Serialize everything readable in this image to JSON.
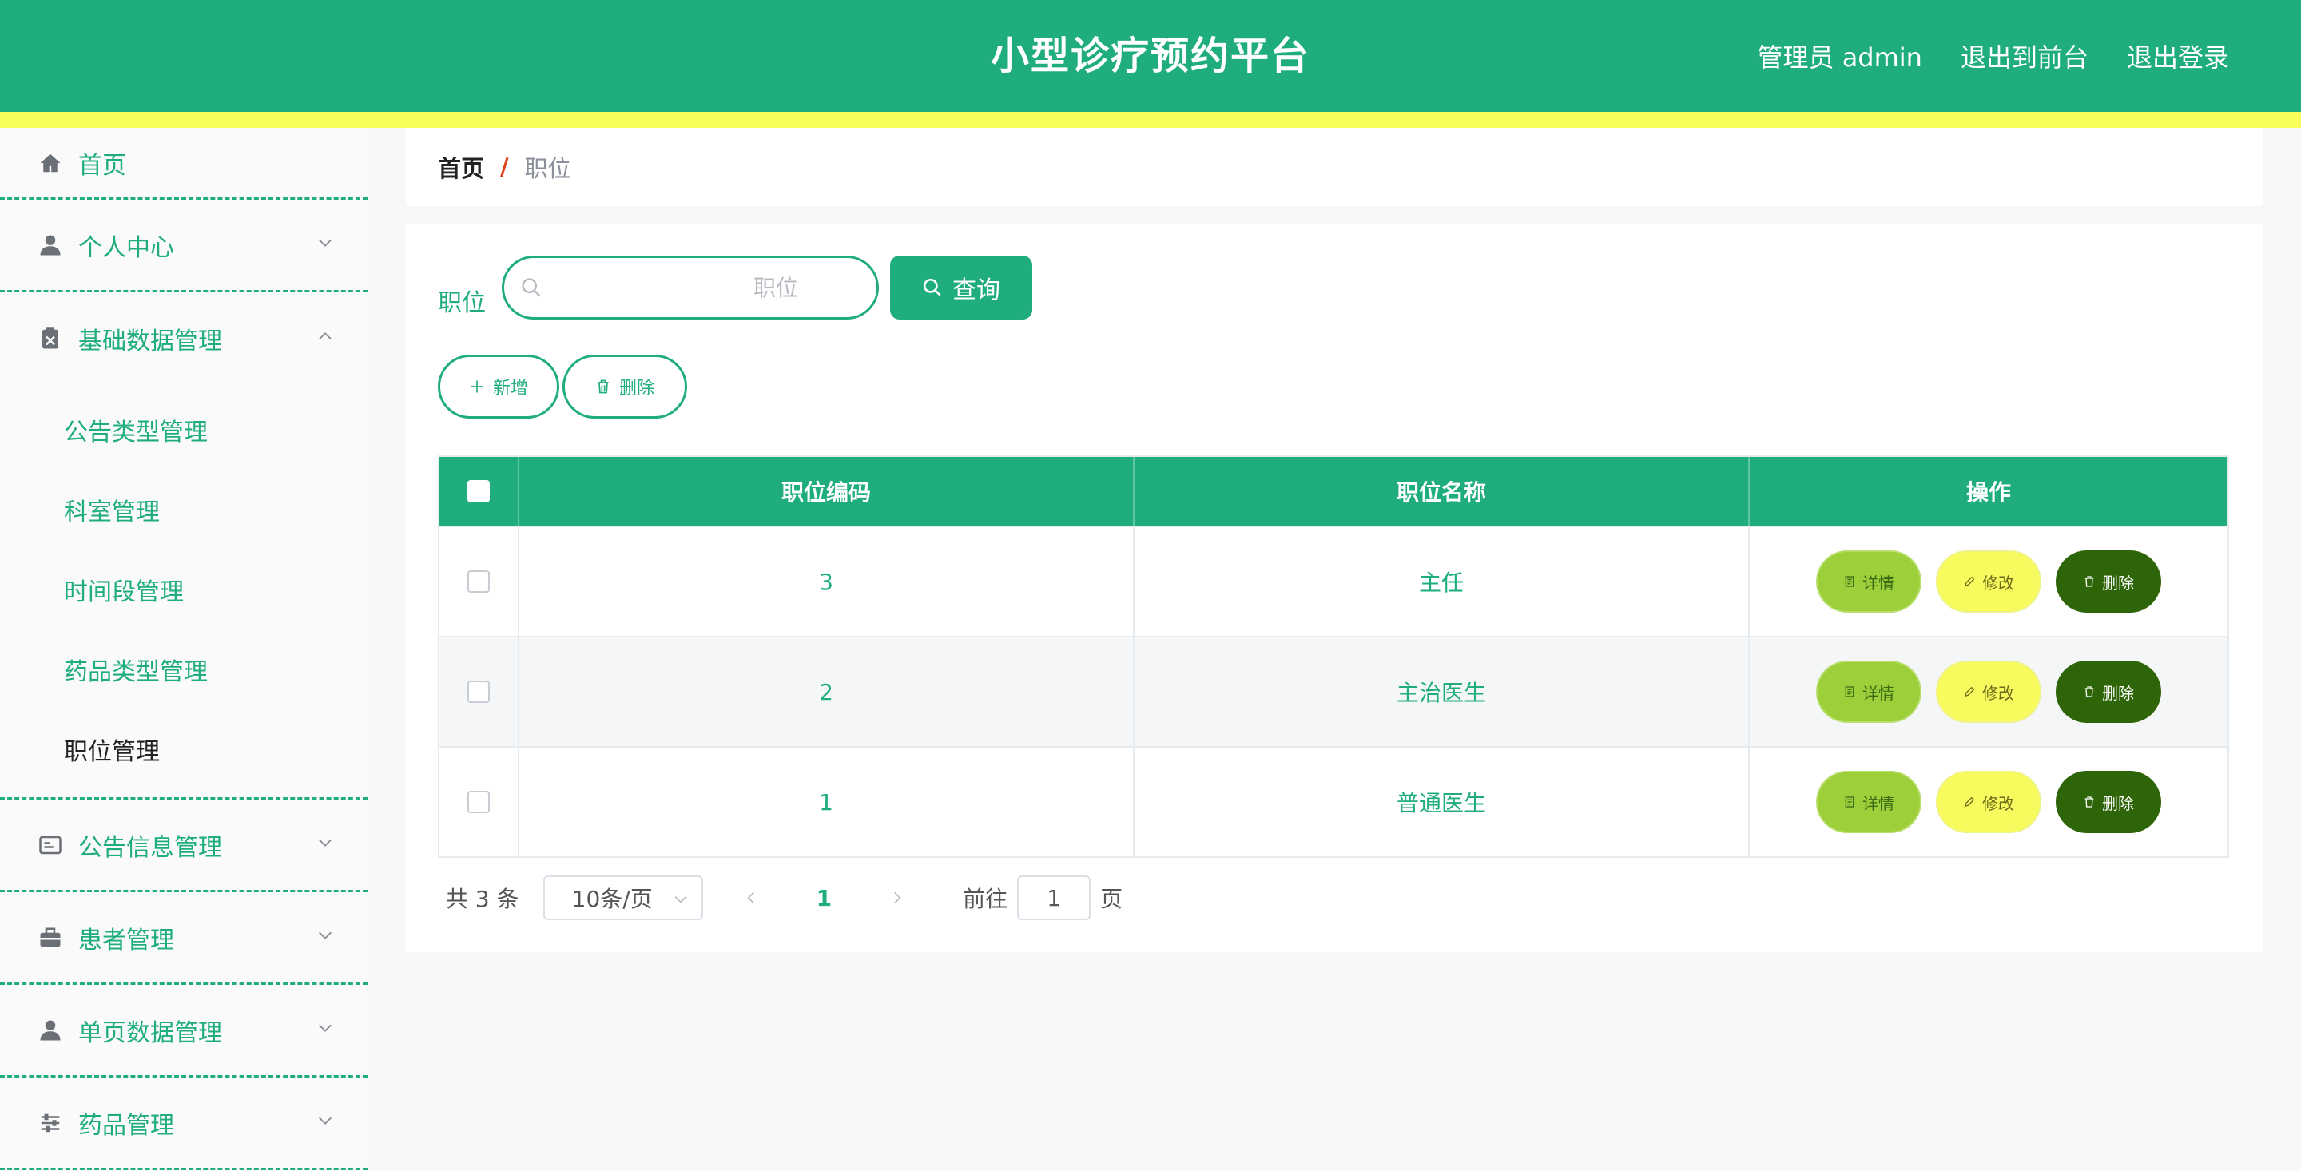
{
  "header": {
    "title": "小型诊疗预约平台",
    "user_label": "管理员 admin",
    "to_front_label": "退出到前台",
    "logout_label": "退出登录"
  },
  "sidebar": {
    "items": [
      {
        "label": "首页",
        "icon": "home-icon"
      },
      {
        "label": "个人中心",
        "icon": "user-icon"
      },
      {
        "label": "基础数据管理",
        "icon": "clipboard-icon"
      },
      {
        "label": "公告信息管理",
        "icon": "id-card-icon"
      },
      {
        "label": "患者管理",
        "icon": "briefcase-icon"
      },
      {
        "label": "单页数据管理",
        "icon": "user-icon"
      },
      {
        "label": "药品管理",
        "icon": "sliders-icon"
      }
    ],
    "submenu": [
      {
        "label": "公告类型管理"
      },
      {
        "label": "科室管理"
      },
      {
        "label": "时间段管理"
      },
      {
        "label": "药品类型管理"
      },
      {
        "label": "职位管理"
      }
    ]
  },
  "breadcrumb": {
    "home": "首页",
    "separator": "/",
    "current": "职位"
  },
  "search": {
    "label": "职位",
    "placeholder": "职位",
    "value": "",
    "button_label": "查询"
  },
  "actions": {
    "add_label": "新增",
    "delete_label": "删除"
  },
  "table": {
    "headers": {
      "code": "职位编码",
      "name": "职位名称",
      "ops": "操作"
    },
    "rows": [
      {
        "code": "3",
        "name": "主任"
      },
      {
        "code": "2",
        "name": "主治医生"
      },
      {
        "code": "1",
        "name": "普通医生"
      }
    ],
    "row_actions": {
      "detail": "详情",
      "edit": "修改",
      "delete": "删除"
    }
  },
  "pagination": {
    "total_text": "共 3 条",
    "page_size": "10条/页",
    "current_page": "1",
    "goto_label": "前往",
    "goto_value": "1",
    "page_suffix": "页"
  },
  "colors": {
    "primary": "#1ead7b",
    "stripe": "#f6ff5c",
    "detail": "#9ccf3a",
    "edit": "#f8fb5e",
    "delete": "#2d6508"
  }
}
